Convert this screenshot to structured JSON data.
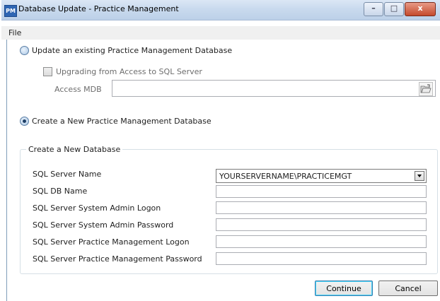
{
  "window": {
    "icon_text": "PM",
    "title": "Database Update - Practice Management",
    "controls": {
      "minimize": "–",
      "maximize": "□",
      "close": "x"
    }
  },
  "menu": {
    "file": "File"
  },
  "existing": {
    "radio_label": "Update an existing Practice Management Database",
    "selected": false,
    "upgrade_checkbox_label": "Upgrading from Access to SQL Server",
    "upgrade_checked": false,
    "access_mdb_label": "Access MDB",
    "access_mdb_value": ""
  },
  "create": {
    "radio_label": "Create a New Practice Management Database",
    "selected": true
  },
  "group": {
    "title": "Create a New Database",
    "fields": {
      "server_name": {
        "label": "SQL Server Name",
        "value": "YOURSERVERNAME\\PRACTICEMGT"
      },
      "db_name": {
        "label": "SQL DB Name",
        "value": ""
      },
      "admin_logon": {
        "label": "SQL Server System Admin Logon",
        "value": ""
      },
      "admin_password": {
        "label": "SQL Server System Admin Password",
        "value": ""
      },
      "pm_logon": {
        "label": "SQL Server Practice Management Logon",
        "value": ""
      },
      "pm_password": {
        "label": "SQL Server Practice Management Password",
        "value": ""
      }
    }
  },
  "buttons": {
    "continue": "Continue",
    "cancel": "Cancel"
  }
}
